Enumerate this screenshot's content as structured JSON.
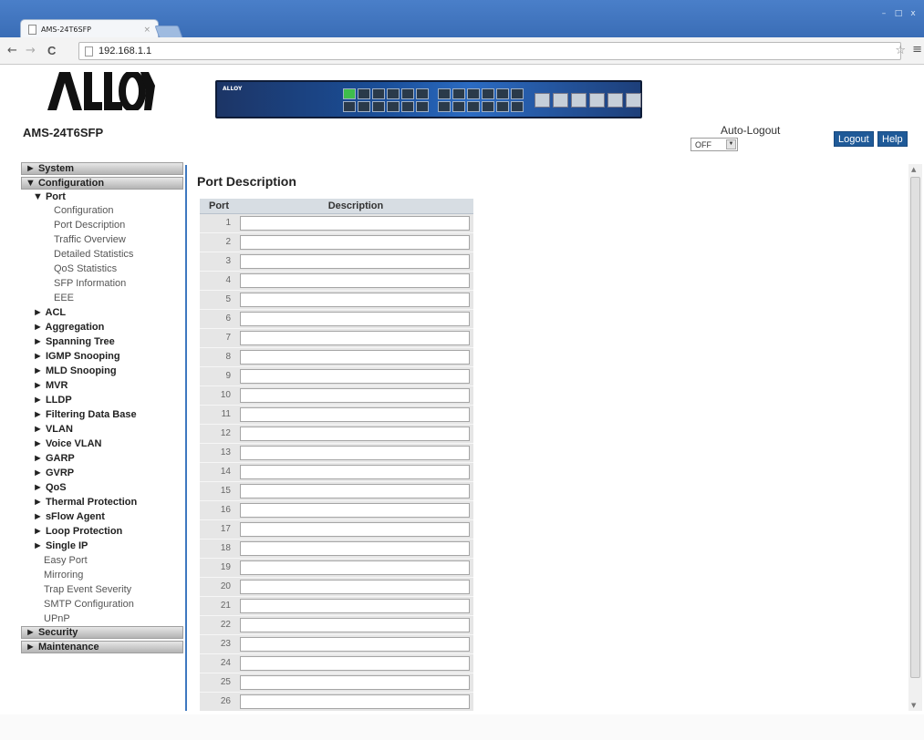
{
  "browser": {
    "tab_title": "AMS-24T6SFP",
    "tab_close": "×",
    "address": "192.168.1.1",
    "back_icon": "←",
    "forward_icon": "→",
    "reload_icon": "C",
    "star_icon": "☆",
    "menu_icon": "≡",
    "minimize": "–",
    "maximize": "□",
    "close": "x"
  },
  "header": {
    "model": "AMS-24T6SFP",
    "autologout_label": "Auto-Logout",
    "autologout_value": "OFF",
    "logout_label": "Logout",
    "help_label": "Help",
    "switch_brand": "ALLOY"
  },
  "sidebar": {
    "system": "► System",
    "configuration": "▼ Configuration",
    "port": "▼ Port",
    "port_items": [
      "Configuration",
      "Port Description",
      "Traffic Overview",
      "Detailed Statistics",
      "QoS Statistics",
      "SFP Information",
      "EEE"
    ],
    "submenus": [
      "► ACL",
      "► Aggregation",
      "► Spanning Tree",
      "► IGMP Snooping",
      "► MLD Snooping",
      "► MVR",
      "► LLDP",
      "► Filtering Data Base",
      "► VLAN",
      "► Voice VLAN",
      "► GARP",
      "► GVRP",
      "► QoS",
      "► Thermal Protection",
      "► sFlow Agent",
      "► Loop Protection",
      "► Single IP"
    ],
    "leaves": [
      "Easy Port",
      "Mirroring",
      "Trap Event Severity",
      "SMTP Configuration",
      "UPnP"
    ],
    "security": "► Security",
    "maintenance": "► Maintenance"
  },
  "main": {
    "title": "Port Description",
    "col_port": "Port",
    "col_description": "Description",
    "ports": [
      "1",
      "2",
      "3",
      "4",
      "5",
      "6",
      "7",
      "8",
      "9",
      "10",
      "11",
      "12",
      "13",
      "14",
      "15",
      "16",
      "17",
      "18",
      "19",
      "20",
      "21",
      "22",
      "23",
      "24",
      "25",
      "26"
    ]
  }
}
